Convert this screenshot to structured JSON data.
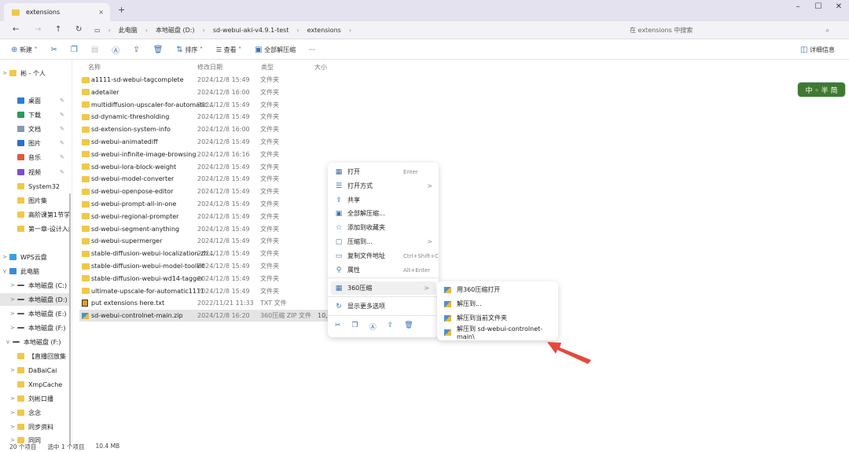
{
  "tab": {
    "title": "extensions",
    "close": "×",
    "new": "+"
  },
  "window": {
    "minimize": "–",
    "maximize": "☐",
    "close": "✕"
  },
  "nav": {
    "back": "←",
    "forward": "→",
    "up": "↑",
    "refresh": "↻"
  },
  "breadcrumb": [
    "此电脑",
    "本地磁盘 (D:)",
    "sd-webui-aki-v4.9.1-test",
    "extensions"
  ],
  "search": {
    "placeholder": "在 extensions 中搜索"
  },
  "toolbar": {
    "new": "新建",
    "sort": "排序",
    "view": "查看",
    "extract_all": "全部解压缩",
    "more": "···",
    "details": "详细信息"
  },
  "sidebar": [
    {
      "label": "彬 - 个人",
      "chev": ">"
    },
    {
      "label": "桌面",
      "pin": true
    },
    {
      "label": "下载",
      "pin": true
    },
    {
      "label": "文档",
      "pin": true
    },
    {
      "label": "图片",
      "pin": true
    },
    {
      "label": "音乐",
      "pin": true
    },
    {
      "label": "视频",
      "pin": true
    },
    {
      "label": "System32"
    },
    {
      "label": "图片集"
    },
    {
      "label": "高阶课第1节学习"
    },
    {
      "label": "第一章-设计入门"
    },
    {
      "label": "WPS云盘",
      "chev": ">"
    },
    {
      "label": "此电脑",
      "chev": "v"
    },
    {
      "label": "本地磁盘 (C:)",
      "chev": ">"
    },
    {
      "label": "本地磁盘 (D:)",
      "chev": ">"
    },
    {
      "label": "本地磁盘 (E:)",
      "chev": ">"
    },
    {
      "label": "本地磁盘 (F:)",
      "chev": ">"
    },
    {
      "label": "本地磁盘 (F:)",
      "chev": "v"
    },
    {
      "label": "【直播回放集"
    },
    {
      "label": "DaBaiCai",
      "chev": ">"
    },
    {
      "label": "XmpCache"
    },
    {
      "label": "刘彬口播",
      "chev": ">"
    },
    {
      "label": "念念",
      "chev": ">"
    },
    {
      "label": "同步资料",
      "chev": ">"
    },
    {
      "label": "同同",
      "chev": ">"
    }
  ],
  "columns": {
    "name": "名称",
    "date": "修改日期",
    "type": "类型",
    "size": "大小"
  },
  "files": [
    {
      "name": "a1111-sd-webui-tagcomplete",
      "date": "2024/12/8 15:49",
      "type": "文件夹"
    },
    {
      "name": "adetailer",
      "date": "2024/12/8 16:00",
      "type": "文件夹"
    },
    {
      "name": "multidiffusion-upscaler-for-automatic...",
      "date": "2024/12/8 15:49",
      "type": "文件夹"
    },
    {
      "name": "sd-dynamic-thresholding",
      "date": "2024/12/8 15:49",
      "type": "文件夹"
    },
    {
      "name": "sd-extension-system-info",
      "date": "2024/12/8 16:00",
      "type": "文件夹"
    },
    {
      "name": "sd-webui-animatediff",
      "date": "2024/12/8 15:49",
      "type": "文件夹"
    },
    {
      "name": "sd-webui-infinite-image-browsing",
      "date": "2024/12/8 16:16",
      "type": "文件夹"
    },
    {
      "name": "sd-webui-lora-block-weight",
      "date": "2024/12/8 15:49",
      "type": "文件夹"
    },
    {
      "name": "sd-webui-model-converter",
      "date": "2024/12/8 15:49",
      "type": "文件夹"
    },
    {
      "name": "sd-webui-openpose-editor",
      "date": "2024/12/8 15:49",
      "type": "文件夹"
    },
    {
      "name": "sd-webui-prompt-all-in-one",
      "date": "2024/12/8 15:49",
      "type": "文件夹"
    },
    {
      "name": "sd-webui-regional-prompter",
      "date": "2024/12/8 15:49",
      "type": "文件夹"
    },
    {
      "name": "sd-webui-segment-anything",
      "date": "2024/12/8 15:49",
      "type": "文件夹"
    },
    {
      "name": "sd-webui-supermerger",
      "date": "2024/12/8 15:49",
      "type": "文件夹"
    },
    {
      "name": "stable-diffusion-webui-localization-zh...",
      "date": "2024/12/8 15:49",
      "type": "文件夹"
    },
    {
      "name": "stable-diffusion-webui-model-toolkit",
      "date": "2024/12/8 15:49",
      "type": "文件夹"
    },
    {
      "name": "stable-diffusion-webui-wd14-tagger",
      "date": "2024/12/8 15:49",
      "type": "文件夹"
    },
    {
      "name": "ultimate-upscale-for-automatic1111",
      "date": "2024/12/8 15:49",
      "type": "文件夹"
    },
    {
      "name": "put extensions here.txt",
      "date": "2022/11/21 11:33",
      "type": "TXT 文件",
      "kind": "txt"
    },
    {
      "name": "sd-webui-controlnet-main.zip",
      "date": "2024/12/8 16:20",
      "type": "360压缩 ZIP 文件",
      "size": "10,6",
      "kind": "zip",
      "selected": true
    }
  ],
  "context_menu": [
    {
      "label": "打开",
      "shortcut": "Enter",
      "icon": "▦"
    },
    {
      "label": "打开方式",
      "arrow": ">",
      "icon": "☰"
    },
    {
      "label": "共享",
      "icon": "⇪"
    },
    {
      "label": "全部解压缩...",
      "icon": "▣"
    },
    {
      "label": "添加到收藏夹",
      "icon": "☆"
    },
    {
      "label": "压缩到...",
      "arrow": ">",
      "icon": "▢"
    },
    {
      "label": "复制文件地址",
      "shortcut": "Ctrl+Shift+C",
      "icon": "▭"
    },
    {
      "label": "属性",
      "shortcut": "Alt+Enter",
      "icon": "⚲"
    },
    {
      "label": "360压缩",
      "arrow": ">",
      "icon": "▦"
    },
    {
      "label": "显示更多选项",
      "icon": "↻"
    }
  ],
  "submenu": [
    "用360压缩打开",
    "解压到...",
    "解压到当前文件夹",
    "解压到 sd-webui-controlnet-main\\"
  ],
  "status": {
    "count": "20 个项目",
    "selected": "选中 1 个项目",
    "size": "10.4 MB"
  },
  "badge": "中 ◦ 半 简",
  "colors": {
    "accent": "#3a6fb0",
    "arrow": "#e8463c"
  }
}
